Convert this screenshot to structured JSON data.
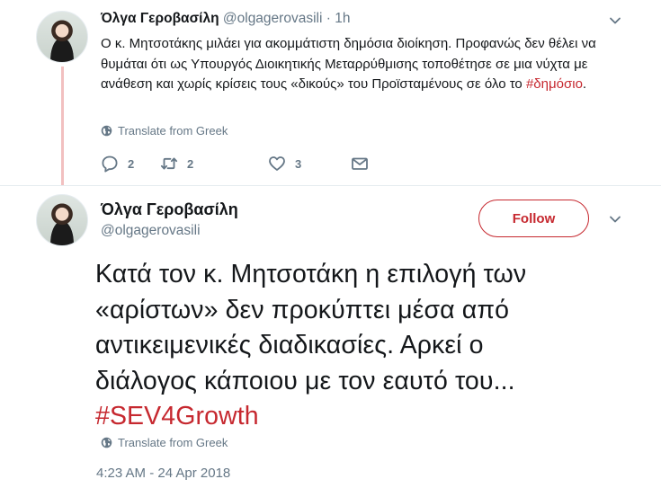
{
  "reply_tweet": {
    "name": "Όλγα Γεροβασίλη",
    "handle": "@olgagerovasili",
    "separator": "·",
    "time": "1h",
    "text_pre": "Ο κ. Μητσοτάκης μιλάει για ακομμάτιστη δημόσια διοίκηση. Προφανώς δεν θέλει να θυμάται ότι ως Υπουργός Διοικητικής Μεταρρύθμισης τοποθέτησε σε μια νύχτα με ανάθεση και χωρίς κρίσεις τους «δικούς» του Προϊσταμένους σε όλο το ",
    "hashtag": "#δημόσιο",
    "text_post": ".",
    "translate": "Translate from Greek",
    "reply_count": "2",
    "retweet_count": "2",
    "like_count": "3"
  },
  "main_tweet": {
    "name": "Όλγα Γεροβασίλη",
    "handle": "@olgagerovasili",
    "follow_label": "Follow",
    "text_lines": [
      "Κατά τον κ. Μητσοτάκη η επιλογή των",
      "«αρίστων» δεν προκύπτει μέσα από",
      "αντικειμενικές διαδικασίες. Αρκεί ο",
      "διάλογος κάποιου με τον εαυτό του..."
    ],
    "hashtag": "#SEV4Growth",
    "translate": "Translate from Greek",
    "timestamp": "4:23 AM - 24 Apr 2018"
  },
  "colors": {
    "hashtag": "#c6282f",
    "follow_accent": "#c6282f",
    "muted": "#657786",
    "thread_line": "#f2c0c0"
  },
  "icons": [
    "globe-icon",
    "reply-icon",
    "retweet-icon",
    "like-icon",
    "message-icon",
    "chevron-down-icon"
  ]
}
